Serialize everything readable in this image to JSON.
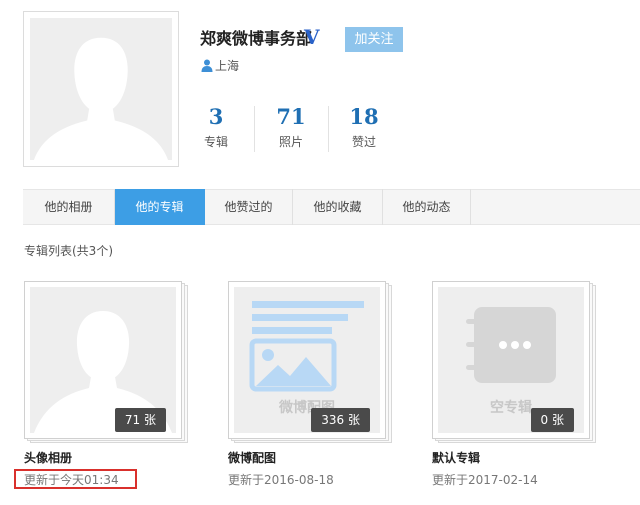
{
  "profile": {
    "name": "郑爽微博事务部",
    "verified_mark": "V",
    "follow_label": "加关注",
    "location": "上海",
    "stats": [
      {
        "value": "3",
        "label": "专辑"
      },
      {
        "value": "71",
        "label": "照片"
      },
      {
        "value": "18",
        "label": "赞过"
      }
    ]
  },
  "tabs": [
    {
      "label": "他的相册",
      "active": false
    },
    {
      "label": "他的专辑",
      "active": true
    },
    {
      "label": "他赞过的",
      "active": false
    },
    {
      "label": "他的收藏",
      "active": false
    },
    {
      "label": "他的动态",
      "active": false
    }
  ],
  "section_title": "专辑列表(共3个)",
  "albums": [
    {
      "title": "头像相册",
      "count": "71 张",
      "updated": "更新于今天01:34",
      "cover_caption": "",
      "icon": "avatar-silhouette-icon"
    },
    {
      "title": "微博配图",
      "count": "336 张",
      "updated": "更新于2016-08-18",
      "cover_caption": "微博配图",
      "icon": "image-post-icon"
    },
    {
      "title": "默认专辑",
      "count": "0 张",
      "updated": "更新于2017-02-14",
      "cover_caption": "空专辑",
      "icon": "empty-album-icon"
    }
  ],
  "colors": {
    "accent": "#3d9ee5",
    "follow_button": "#8ec4ec",
    "stat_number": "#1f6fb3",
    "verify": "#2a62c9",
    "highlight": "#d9302c"
  }
}
